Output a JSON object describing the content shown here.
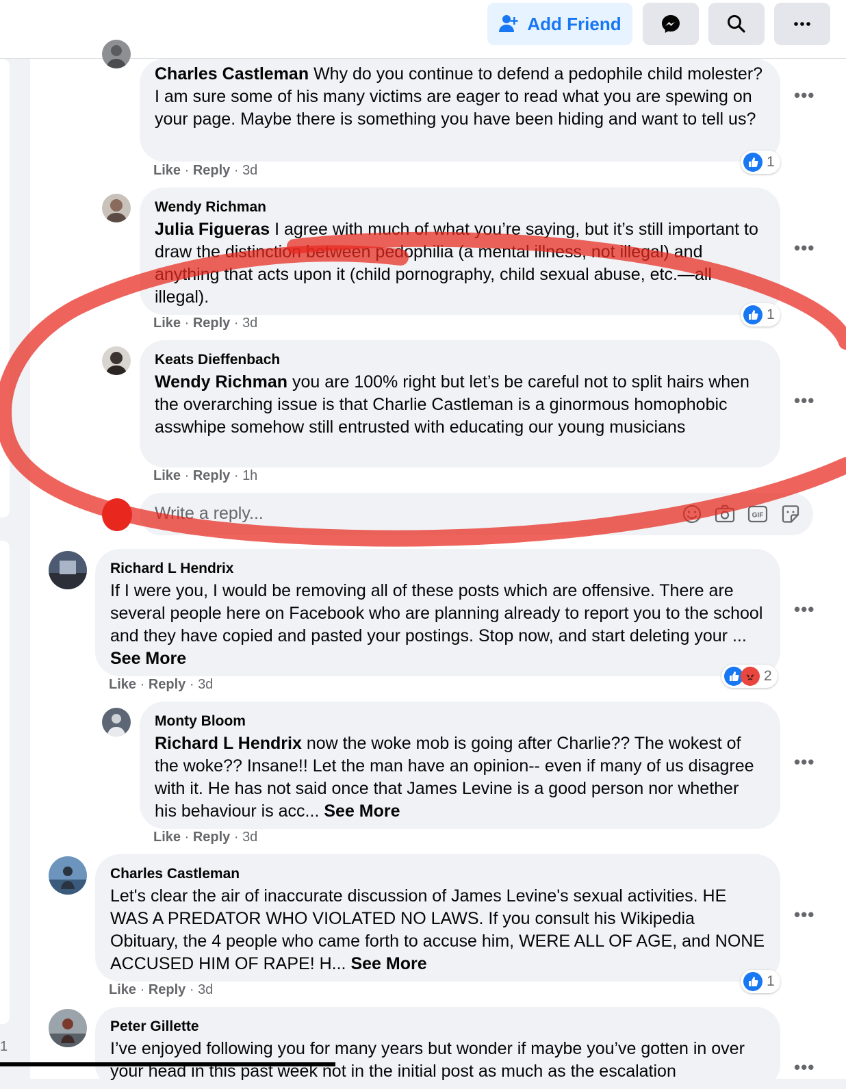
{
  "topbar": {
    "add_friend_label": "Add Friend",
    "icons": [
      "add-person-icon",
      "messenger-icon",
      "search-icon",
      "more-icon"
    ]
  },
  "comments": [
    {
      "name": "",
      "mention": "Charles Castleman",
      "text": "Why do you continue to defend a pedophile child molester? I am sure some of his many victims are eager to read what you are spewing on your page. Maybe there is something you have been hiding and want to tell us?",
      "like": "Like",
      "reply": "Reply",
      "time": "3d",
      "reaction_count": "1"
    },
    {
      "name": "Wendy Richman",
      "mention": "Julia Figueras",
      "text": "I agree with much of what you’re saying, but it’s still important to draw the distinction between pedophilia (a mental illness, not illegal) and anything that acts upon it (child pornography, child sexual abuse, etc.—all illegal).",
      "like": "Like",
      "reply": "Reply",
      "time": "3d",
      "reaction_count": "1"
    },
    {
      "name": "Keats Dieffenbach",
      "mention": "Wendy Richman",
      "text": "you are 100% right but let’s be careful not to split hairs when the overarching issue is that Charlie Castleman is a ginormous homophobic asswhipe somehow still entrusted with educating our young musicians",
      "like": "Like",
      "reply": "Reply",
      "time": "1h"
    },
    {
      "name": "Richard L Hendrix",
      "text": "If I were you, I would be removing all of these posts which are offensive. There are several people here on Facebook who are planning already to report you to the school and they have copied and pasted your postings. Stop now, and start deleting your ...",
      "see_more": "See More",
      "like": "Like",
      "reply": "Reply",
      "time": "3d",
      "reaction_count": "2"
    },
    {
      "name": "Monty Bloom",
      "mention": "Richard L Hendrix",
      "text": "now the woke mob is going after Charlie?? The wokest of the woke?? Insane!! Let the man have an opinion-- even if many of us disagree with it. He has not said once that James Levine is a good person nor whether his behaviour is acc...",
      "see_more": "See More",
      "like": "Like",
      "reply": "Reply",
      "time": "3d"
    },
    {
      "name": "Charles Castleman",
      "text": "Let's clear the air of inaccurate discussion of James Levine's sexual activities. HE WAS A PREDATOR WHO VIOLATED NO LAWS. If you consult his Wikipedia Obituary, the 4 people who came forth to accuse him, WERE ALL OF AGE, and NONE ACCUSED HIM OF RAPE! H...",
      "see_more": "See More",
      "like": "Like",
      "reply": "Reply",
      "time": "3d",
      "reaction_count": "1"
    },
    {
      "name": "Peter Gillette",
      "text": "I’ve enjoyed following you for many years but wonder if maybe you’ve gotten in over your head in this past week not in the initial post as much as the escalation"
    }
  ],
  "reply_box": {
    "placeholder": "Write a reply...",
    "icons": [
      "emoji-icon",
      "camera-icon",
      "gif-icon",
      "sticker-icon"
    ]
  },
  "left_edge_number": "1",
  "colors": {
    "brand": "#1877f2",
    "annotation": "#e8281e",
    "bubble": "#f0f2f5",
    "meta_text": "#65676b"
  }
}
